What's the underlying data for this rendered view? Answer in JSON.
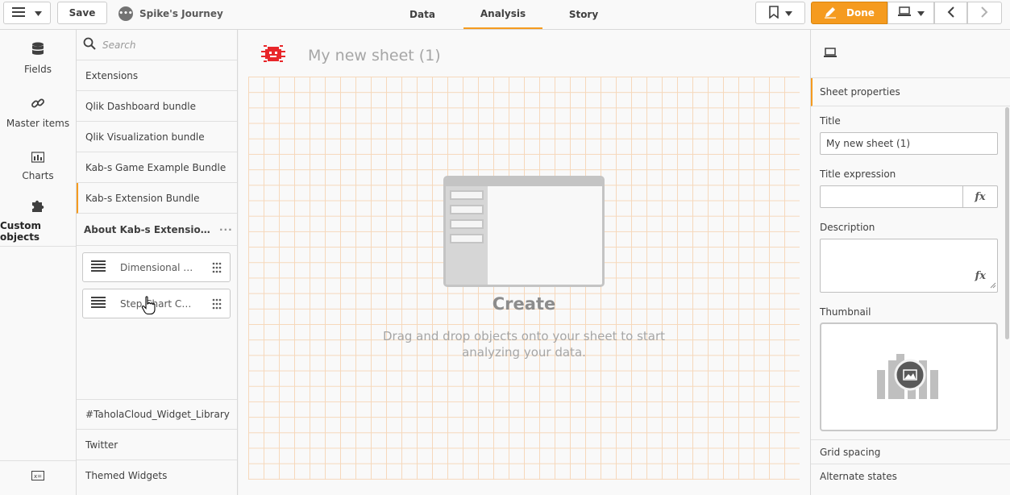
{
  "toolbar": {
    "save_label": "Save",
    "app_title": "Spike's Journey",
    "tabs": [
      {
        "label": "Data"
      },
      {
        "label": "Analysis"
      },
      {
        "label": "Story"
      }
    ],
    "done_label": "Done"
  },
  "rail": {
    "items": [
      {
        "label": "Fields",
        "icon": "database-icon"
      },
      {
        "label": "Master items",
        "icon": "link-icon"
      },
      {
        "label": "Charts",
        "icon": "bar-chart-icon"
      },
      {
        "label": "Custom objects",
        "icon": "puzzle-icon"
      }
    ]
  },
  "assets": {
    "search_placeholder": "Search",
    "bundles_top": [
      {
        "label": "Extensions"
      },
      {
        "label": "Qlik Dashboard bundle"
      },
      {
        "label": "Qlik Visualization bundle"
      },
      {
        "label": "Kab-s Game Example Bundle"
      },
      {
        "label": "Kab-s Extension Bundle"
      }
    ],
    "about_label": "About Kab-s Extension Bundle",
    "extensions": [
      {
        "label": "Dimensional Selector"
      },
      {
        "label": "Step Chart Component"
      }
    ],
    "bundles_bottom": [
      {
        "label": "#TaholaCloud_Widget_Library"
      },
      {
        "label": "Twitter"
      },
      {
        "label": "Themed Widgets"
      }
    ]
  },
  "sheet": {
    "title": "My new sheet (1)",
    "create_title": "Create",
    "create_desc": "Drag and drop objects onto your sheet to start analyzing your data."
  },
  "props": {
    "section": "Sheet properties",
    "title_label": "Title",
    "title_value": "My new sheet (1)",
    "title_expression_label": "Title expression",
    "title_expression_value": "",
    "description_label": "Description",
    "thumbnail_label": "Thumbnail",
    "fx": "fx",
    "grid_spacing_label": "Grid spacing",
    "alternate_states_label": "Alternate states"
  },
  "colors": {
    "accent": "#f59b1f",
    "grid": "#f6d3b1",
    "sheet_icon": "#e8262a"
  }
}
